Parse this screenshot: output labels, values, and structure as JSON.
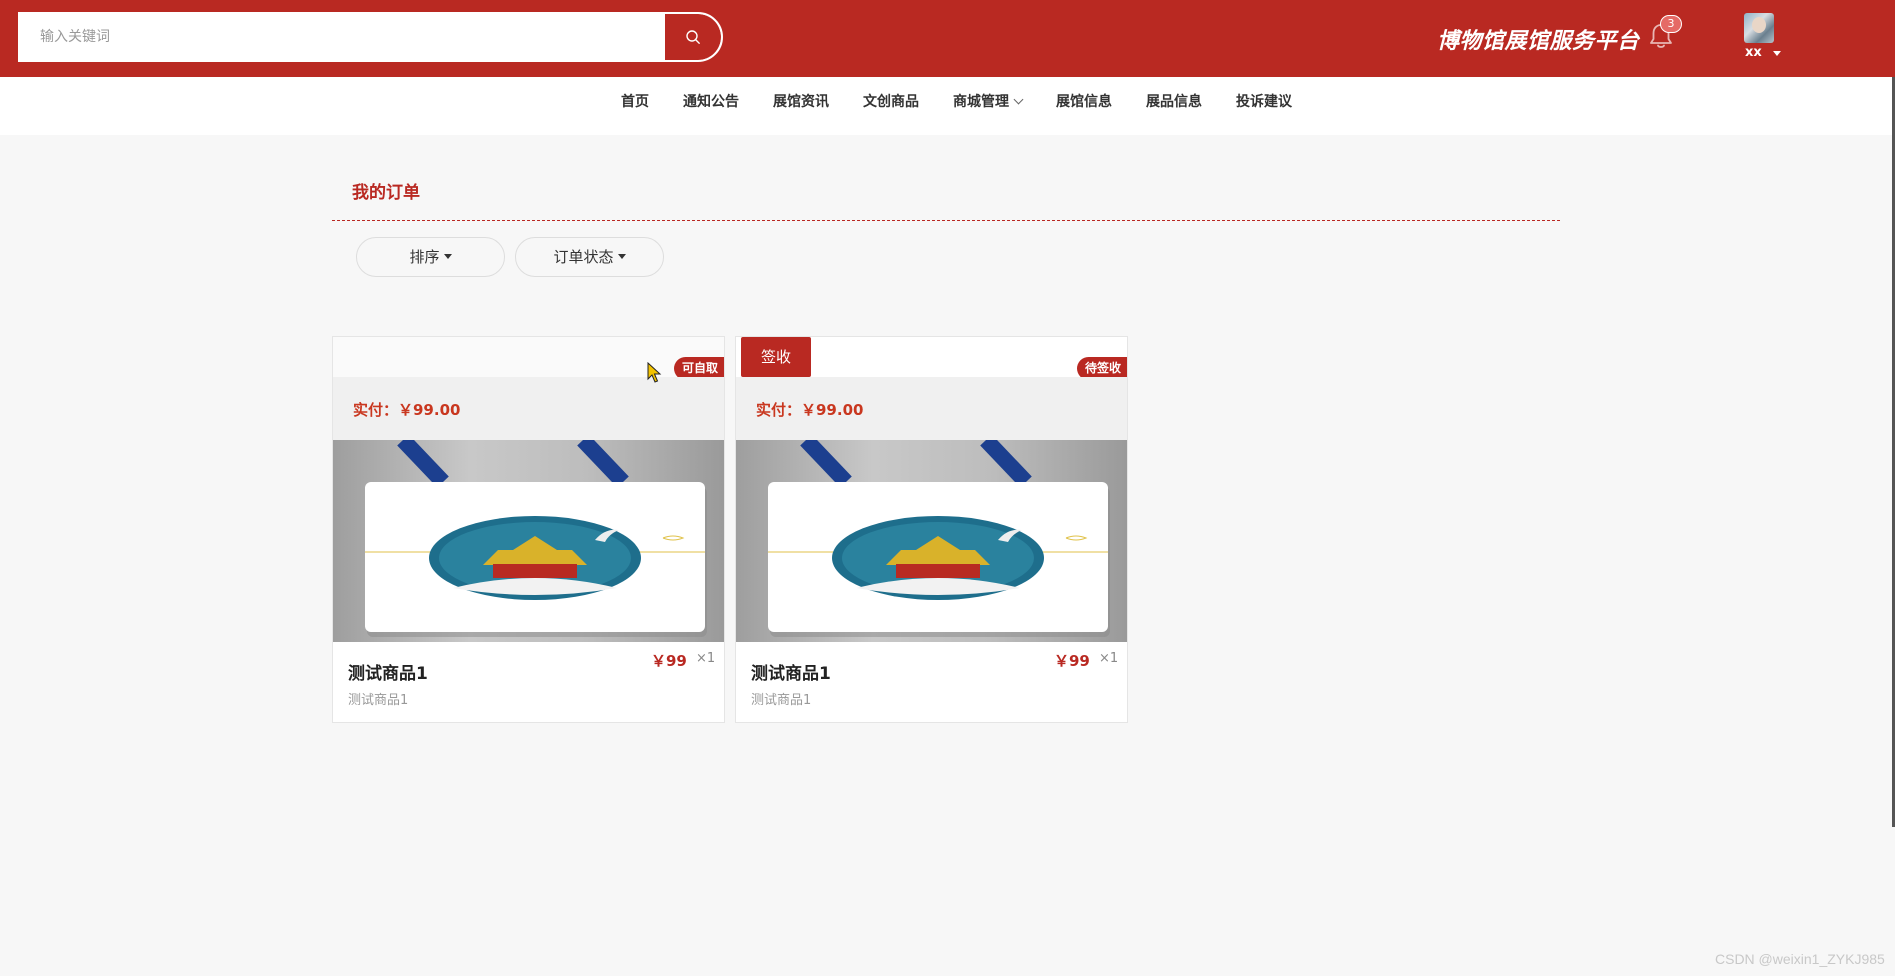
{
  "header": {
    "search_placeholder": "输入关键词",
    "platform_title": "博物馆展馆服务平台",
    "notification_count": "3",
    "user_name": "xx",
    "brand_color": "#b92922"
  },
  "nav": {
    "items": [
      "首页",
      "通知公告",
      "展馆资讯",
      "文创商品",
      "商城管理",
      "展馆信息",
      "展品信息",
      "投诉建议"
    ]
  },
  "page": {
    "title": "我的订单",
    "filters": {
      "sort_label": "排序",
      "status_label": "订单状态"
    }
  },
  "orders": [
    {
      "status": "可自取",
      "paid": "实付：￥99.00",
      "name": "测试商品1",
      "subtitle": "测试商品1",
      "price": "￥99",
      "qty": "×1",
      "action": ""
    },
    {
      "status": "待签收",
      "paid": "实付：￥99.00",
      "name": "测试商品1",
      "subtitle": "测试商品1",
      "price": "￥99",
      "qty": "×1",
      "action": "签收"
    }
  ],
  "watermark": "CSDN @weixin1_ZYKJ985",
  "icons": [
    "search-icon",
    "bell-icon",
    "chevron-down-icon",
    "caret-down-icon"
  ]
}
